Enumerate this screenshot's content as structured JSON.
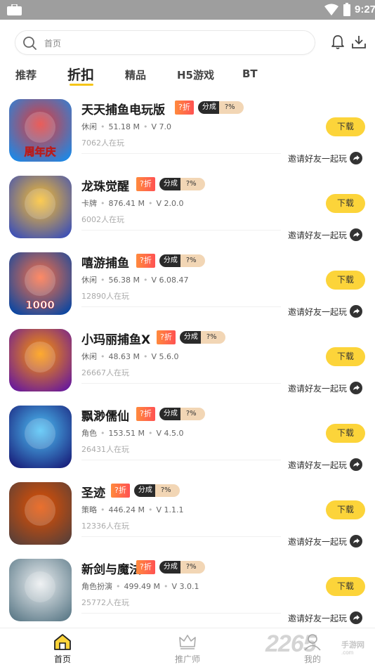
{
  "status_bar": {
    "time": "9:27"
  },
  "search": {
    "placeholder": "首页"
  },
  "tabs": [
    {
      "label": "推荐"
    },
    {
      "label": "折扣"
    },
    {
      "label": "精品"
    },
    {
      "label": "H5游戏"
    },
    {
      "label": "BT"
    }
  ],
  "tag_labels": {
    "discount": "?折",
    "share_left": "分成",
    "share_right": "?%"
  },
  "download_label": "下载",
  "invite_label": "邀请好友一起玩",
  "games": [
    {
      "name": "天天捕鱼电玩版",
      "category": "休闲",
      "size": "51.18 M",
      "version": "V 7.0",
      "players": "7062人在玩",
      "icon_text": "周年庆",
      "icon_bg": "#1e88e5",
      "icon_accent": "#e53935"
    },
    {
      "name": "龙珠觉醒",
      "category": "卡牌",
      "size": "876.41 M",
      "version": "V 2.0.0",
      "players": "6002人在玩",
      "icon_text": "",
      "icon_bg": "#3f51b5",
      "icon_accent": "#fbc02d"
    },
    {
      "name": "嘻游捕鱼",
      "category": "休闲",
      "size": "56.38 M",
      "version": "V 6.08.47",
      "players": "12890人在玩",
      "icon_text": "1000",
      "icon_bg": "#0d47a1",
      "icon_accent": "#ff7043"
    },
    {
      "name": "小玛丽捕鱼X",
      "category": "休闲",
      "size": "48.63 M",
      "version": "V 5.6.0",
      "players": "26667人在玩",
      "icon_text": "",
      "icon_bg": "#6a1b9a",
      "icon_accent": "#ff9800"
    },
    {
      "name": "飘渺儒仙",
      "category": "角色",
      "size": "153.51 M",
      "version": "V 4.5.0",
      "players": "26431人在玩",
      "icon_text": "",
      "icon_bg": "#1a237e",
      "icon_accent": "#4fc3f7"
    },
    {
      "name": "圣迹",
      "category": "策略",
      "size": "446.24 M",
      "version": "V 1.1.1",
      "players": "12336人在玩",
      "icon_text": "",
      "icon_bg": "#5d4037",
      "icon_accent": "#e65100"
    },
    {
      "name": "新剑与魔法",
      "category": "角色扮演",
      "size": "499.49 M",
      "version": "V 3.0.1",
      "players": "25772人在玩",
      "icon_text": "",
      "icon_bg": "#607d8b",
      "icon_accent": "#eceff1"
    }
  ],
  "bottom_nav": [
    {
      "label": "首页",
      "icon": "home-icon"
    },
    {
      "label": "推广师",
      "icon": "crown-icon"
    },
    {
      "label": "我的",
      "icon": "user-icon"
    }
  ],
  "watermark": {
    "number": "2265",
    "text": "手游网",
    "domain": ".com"
  },
  "colors": {
    "accent_yellow": "#fcd43a",
    "tab_underline": "#f5c518",
    "discount_tag": "#ff5252",
    "share_tag_dark": "#2a2a2a",
    "share_tag_light": "#f2d6b5"
  }
}
